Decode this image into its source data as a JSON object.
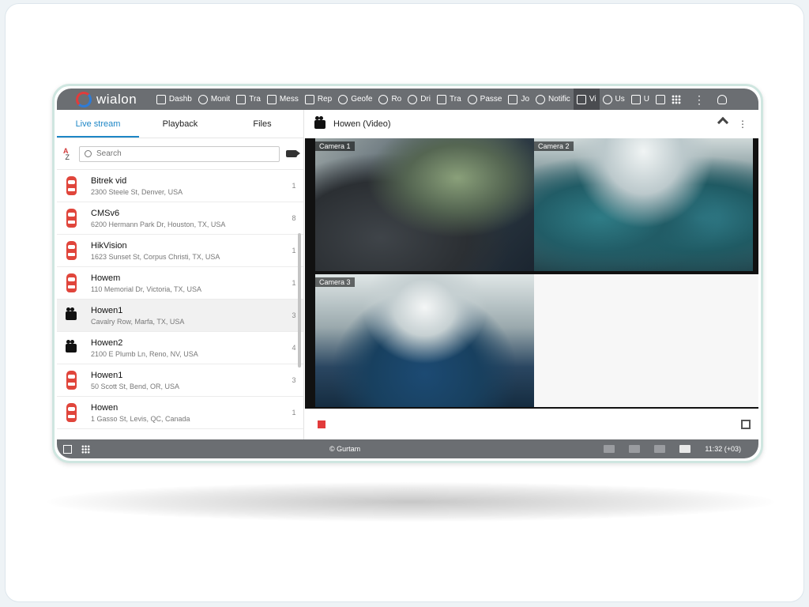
{
  "app": {
    "logo_text": "wialon"
  },
  "nav": {
    "items": [
      {
        "label": "Dashb",
        "icon": "chart-icon"
      },
      {
        "label": "Monit",
        "icon": "globe-icon"
      },
      {
        "label": "Tra",
        "icon": "flag-icon"
      },
      {
        "label": "Mess",
        "icon": "messages-icon"
      },
      {
        "label": "Rep",
        "icon": "report-icon"
      },
      {
        "label": "Geofe",
        "icon": "geofence-icon"
      },
      {
        "label": "Ro",
        "icon": "route-icon"
      },
      {
        "label": "Dri",
        "icon": "driver-icon"
      },
      {
        "label": "Tra",
        "icon": "trailer-icon"
      },
      {
        "label": "Passe",
        "icon": "passenger-icon"
      },
      {
        "label": "Jo",
        "icon": "jobs-icon"
      },
      {
        "label": "Notific",
        "icon": "alarm-icon"
      },
      {
        "label": "Vi",
        "icon": "video-icon"
      },
      {
        "label": "Us",
        "icon": "user-icon"
      },
      {
        "label": "U",
        "icon": "bus-icon"
      }
    ],
    "active_index": 12
  },
  "left_panel": {
    "tabs": [
      "Live stream",
      "Playback",
      "Files"
    ],
    "active_tab": 0,
    "sort_icon": "A Z",
    "search_placeholder": "Search",
    "units": [
      {
        "name": "Bitrek vid",
        "address": "2300 Steele St, Denver, USA",
        "count": "1",
        "icon": "car-icon"
      },
      {
        "name": "CMSv6",
        "address": "6200 Hermann Park Dr, Houston, TX, USA",
        "count": "8",
        "icon": "car-icon"
      },
      {
        "name": "HikVision",
        "address": "1623 Sunset St, Corpus Christi, TX, USA",
        "count": "1",
        "icon": "car-icon"
      },
      {
        "name": "Howem",
        "address": "110 Memorial Dr, Victoria, TX, USA",
        "count": "1",
        "icon": "car-icon"
      },
      {
        "name": "Howen1",
        "address": "Cavalry Row, Marfa, TX, USA",
        "count": "3",
        "icon": "videocam-icon",
        "selected": true
      },
      {
        "name": "Howen2",
        "address": "2100 E Plumb Ln, Reno, NV, USA",
        "count": "4",
        "icon": "videocam-icon"
      },
      {
        "name": "Howen1",
        "address": "50 Scott St, Bend, OR, USA",
        "count": "3",
        "icon": "car-icon"
      },
      {
        "name": "Howen",
        "address": "1 Gasso St, Levis, QC, Canada",
        "count": "1",
        "icon": "car-icon"
      }
    ]
  },
  "video": {
    "title": "Howen (Video)",
    "cameras": [
      "Camera 1",
      "Camera 2",
      "Camera 3"
    ]
  },
  "footer": {
    "copyright": "© Gurtam",
    "time": "11:32 (+03)"
  }
}
